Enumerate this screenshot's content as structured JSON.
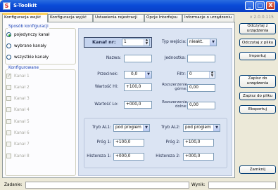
{
  "window": {
    "title": "S-Toolkit",
    "app_icon": "S",
    "controls": {
      "minimize": "_",
      "maximize": "□",
      "close": "X"
    }
  },
  "tabs": [
    {
      "label": "Konfiguracja wejść",
      "active": true
    },
    {
      "label": "Konfiguracja wyjść",
      "active": false
    },
    {
      "label": "Ustawienia rejestracji",
      "active": false
    },
    {
      "label": "Opcje Interfejsu",
      "active": false
    },
    {
      "label": "Informacje o urządzeniu",
      "active": false
    }
  ],
  "version": "v 2.0.0.115",
  "config_mode": {
    "title": "Sposób konfiguracji",
    "options": [
      {
        "label": "pojedynczy kanał",
        "selected": true
      },
      {
        "label": "wybrane kanały",
        "selected": false
      },
      {
        "label": "wszystkie kanały",
        "selected": false
      }
    ]
  },
  "configured": {
    "title": "Konfigurowane",
    "channels": [
      {
        "label": "Kanał 1",
        "checked": true
      },
      {
        "label": "Kanał 2",
        "checked": false
      },
      {
        "label": "Kanał 3",
        "checked": false
      },
      {
        "label": "Kanał 4",
        "checked": false
      },
      {
        "label": "Kanał 5",
        "checked": false
      },
      {
        "label": "Kanał 6",
        "checked": false
      },
      {
        "label": "Kanał 7",
        "checked": false
      },
      {
        "label": "Kanał 8",
        "checked": false
      }
    ]
  },
  "form": {
    "kanal_label": "Kanał nr:",
    "kanal_value": "1",
    "typ_label": "Typ wejścia:",
    "typ_value": "nieakt.",
    "nazwa_label": "Nazwa:",
    "nazwa_value": "",
    "jednostka_label": "Jednostka:",
    "jednostka_value": "",
    "przecinek_label": "Przecinek:",
    "przecinek_value": "0,0",
    "filtr_label": "Filtr:",
    "filtr_value": "0",
    "hi_label": "Wartość Hi:",
    "hi_value": "+100,0",
    "roz_gorne_label": "Rozszerzenie górne:",
    "roz_gorne_value": "0,00",
    "lo_label": "Wartość Lo:",
    "lo_value": "+000,0",
    "roz_dolne_label": "Rozszerzenie dolne:",
    "roz_dolne_value": "0,00",
    "tryb1_label": "Tryb AL1:",
    "tryb1_value": "pod progiem",
    "tryb2_label": "Tryb AL2:",
    "tryb2_value": "pod progiem",
    "prog1_label": "Próg 1:",
    "prog1_value": "+100,0",
    "prog2_label": "Próg 2:",
    "prog2_value": "+100,0",
    "hist1_label": "Histereza 1:",
    "hist1_value": "+000,0",
    "hist2_label": "Histereza 2:",
    "hist2_value": "+000,0"
  },
  "buttons": {
    "read_device": "Odczytaj z urządzenia",
    "read_file": "Odczytaj z pliku",
    "import": "Importuj",
    "write_device": "Zapisz do urządzenia",
    "write_file": "Zapisz do pliku",
    "export": "Eksportuj",
    "close": "Zamknij"
  },
  "status": {
    "task_label": "Zadanie:",
    "result_label": "Wynik:"
  }
}
